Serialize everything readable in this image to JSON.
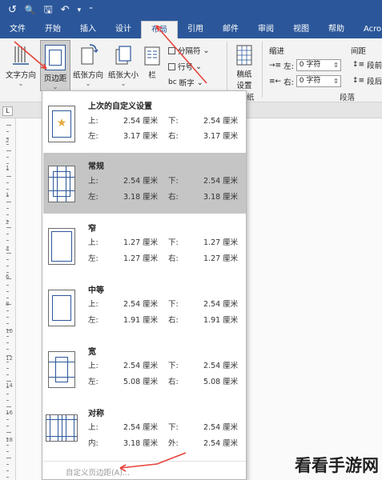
{
  "title_bar": {
    "autosave_glyph": "↺",
    "preview_glyph": "🔍",
    "save_glyph": "🖫",
    "undo_glyph": "↶",
    "undo_dropdown_glyph": "▾",
    "customize_glyph": "⁼"
  },
  "tabs": [
    {
      "label": "文件"
    },
    {
      "label": "开始"
    },
    {
      "label": "插入"
    },
    {
      "label": "设计"
    },
    {
      "label": "布局"
    },
    {
      "label": "引用"
    },
    {
      "label": "邮件"
    },
    {
      "label": "审阅"
    },
    {
      "label": "视图"
    },
    {
      "label": "帮助"
    },
    {
      "label": "Acroba"
    }
  ],
  "ribbon": {
    "text_direction": "文字方向",
    "margins": "页边距",
    "orientation": "纸张方向",
    "size": "纸张大小",
    "columns": "栏",
    "breaks": "分隔符",
    "line_numbers": "行号",
    "hyphenation": "断字",
    "draft_settings_line1": "稿纸",
    "draft_settings_line2": "设置",
    "indent_header": "缩进",
    "spacing_header": "间距",
    "indent_left_label": "左:",
    "indent_left_value": "0 字符",
    "indent_right_label": "右:",
    "indent_right_value": "0 字符",
    "spacing_before_label": "段前:",
    "spacing_after_label": "段后:",
    "group_paragraph": "段落",
    "group_draft_partial": "纸"
  },
  "ruler": {
    "corner_glyph": "L",
    "numbers": [
      "2",
      "1",
      "1",
      "2",
      "4",
      "6",
      "8",
      "10",
      "12",
      "14",
      "16",
      "18"
    ]
  },
  "margins_menu": {
    "options": [
      {
        "name": "上次的自定义设置",
        "top_label": "上:",
        "top": "2.54 厘米",
        "bottom_label": "下:",
        "bottom": "2.54 厘米",
        "side1_label": "左:",
        "side1": "3.17 厘米",
        "side2_label": "右:",
        "side2": "3.17 厘米"
      },
      {
        "name": "常规",
        "top_label": "上:",
        "top": "2.54 厘米",
        "bottom_label": "下:",
        "bottom": "2.54 厘米",
        "side1_label": "左:",
        "side1": "3.18 厘米",
        "side2_label": "右:",
        "side2": "3.18 厘米"
      },
      {
        "name": "窄",
        "top_label": "上:",
        "top": "1.27 厘米",
        "bottom_label": "下:",
        "bottom": "1.27 厘米",
        "side1_label": "左:",
        "side1": "1.27 厘米",
        "side2_label": "右:",
        "side2": "1.27 厘米"
      },
      {
        "name": "中等",
        "top_label": "上:",
        "top": "2.54 厘米",
        "bottom_label": "下:",
        "bottom": "2.54 厘米",
        "side1_label": "左:",
        "side1": "1.91 厘米",
        "side2_label": "右:",
        "side2": "1.91 厘米"
      },
      {
        "name": "宽",
        "top_label": "上:",
        "top": "2.54 厘米",
        "bottom_label": "下:",
        "bottom": "2.54 厘米",
        "side1_label": "左:",
        "side1": "5.08 厘米",
        "side2_label": "右:",
        "side2": "5.08 厘米"
      },
      {
        "name": "对称",
        "top_label": "上:",
        "top": "2.54 厘米",
        "bottom_label": "下:",
        "bottom": "2.54 厘米",
        "side1_label": "内:",
        "side1": "3.18 厘米",
        "side2_label": "外:",
        "side2": "2.54 厘米"
      }
    ],
    "custom_margins": "自定义页边距(A)..."
  },
  "watermark": "看看手游网",
  "colors": {
    "accent": "#2b579a",
    "annotation": "#e5433b",
    "selected": "#c5c5c5"
  }
}
